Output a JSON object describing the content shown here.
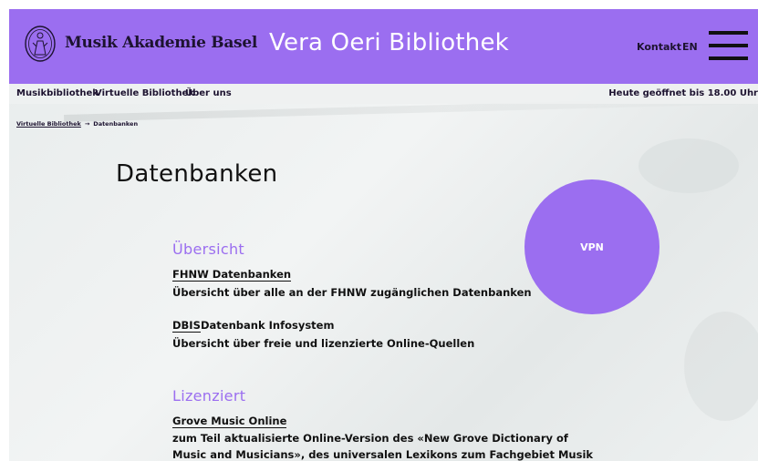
{
  "header": {
    "logo_text": "Musik Akademie Basel",
    "site_title": "Vera Oeri Bibliothek",
    "contact_label": "Kontakt",
    "lang_label": "EN",
    "brand_color": "#9b6ef0"
  },
  "subnav": {
    "items": [
      "Musikbibliothek",
      "Virtuelle Bibliothek",
      "Über uns"
    ],
    "hours": "Heute geöffnet bis 18.00 Uhr"
  },
  "breadcrumb": {
    "parent": "Virtuelle Bibliothek",
    "current": "Datenbanken"
  },
  "main": {
    "title": "Datenbanken",
    "vpn_label": "VPN",
    "sections": [
      {
        "heading": "Übersicht",
        "entries": [
          {
            "link": "FHNW Datenbanken",
            "suffix": "",
            "description": "Übersicht über alle an der FHNW zugänglichen Datenbanken"
          },
          {
            "link": "DBIS",
            "suffix": " Datenbank Infosystem",
            "description": "Übersicht über freie und lizenzierte Online-Quellen"
          }
        ]
      },
      {
        "heading": "Lizenziert",
        "entries": [
          {
            "link": "Grove Music Online",
            "suffix": "",
            "description": "zum Teil aktualisierte Online-Version des «New Grove Dictionary of Music and Musicians», des universalen Lexikons zum Fachgebiet Musik"
          }
        ]
      }
    ]
  }
}
